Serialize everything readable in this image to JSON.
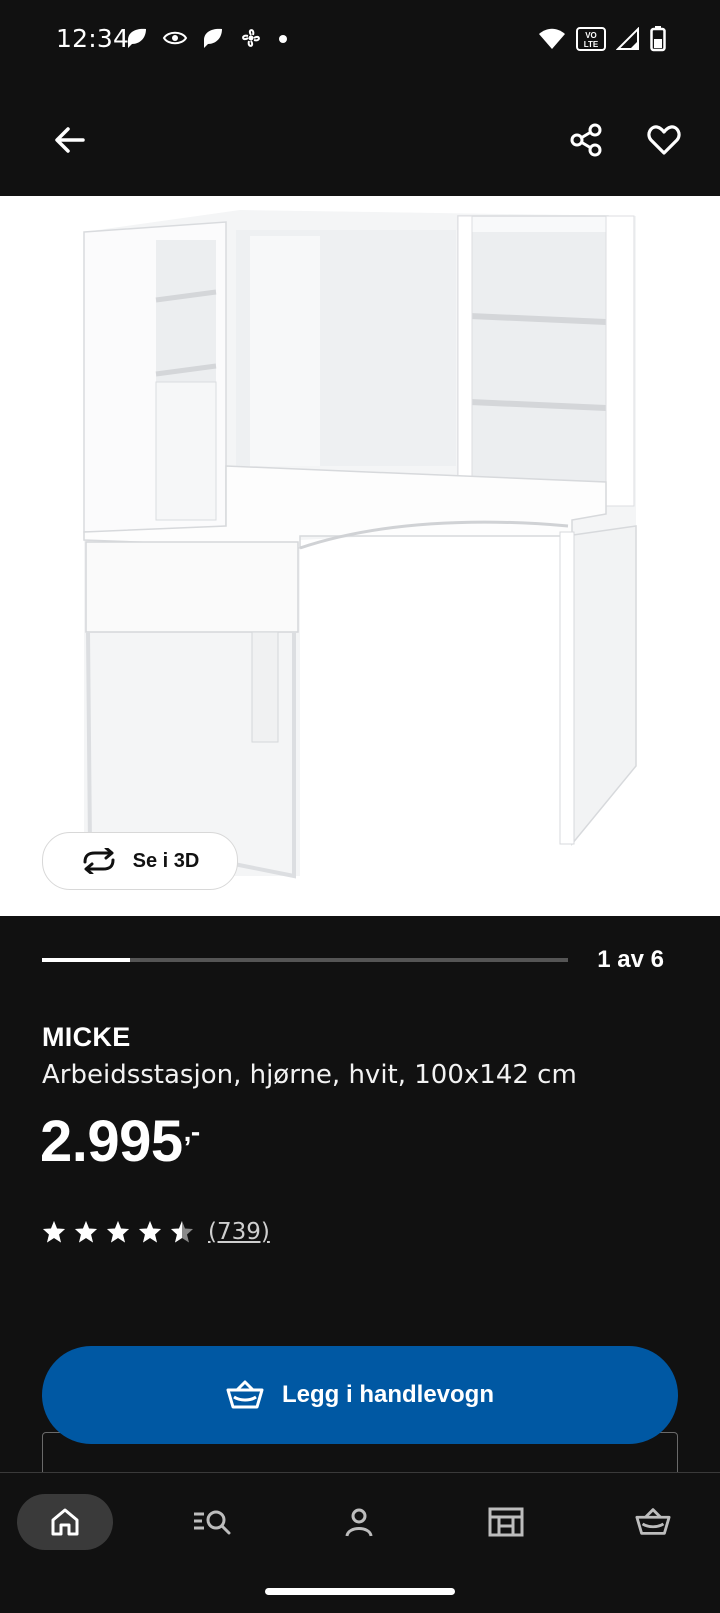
{
  "status_bar": {
    "time": "12:34",
    "left_icons": [
      "leaf-icon",
      "eye-icon",
      "leaf-icon",
      "fan-icon",
      "dot-icon"
    ],
    "right_icons": [
      "wifi-icon",
      "volte-icon",
      "signal-icon",
      "battery-icon"
    ],
    "volte_label": "VO LTE"
  },
  "top_bar": {
    "back_icon": "arrow-left-icon",
    "share_icon": "share-icon",
    "favorite_icon": "heart-icon"
  },
  "gallery": {
    "see_3d_label": "Se i 3D",
    "progress_fraction": 0.1667,
    "pager_text": "1 av 6"
  },
  "product": {
    "brand": "MICKE",
    "description": "Arbeidsstasjon, hjørne, hvit, 100x142 cm",
    "price": "2.995",
    "price_suffix": ",-",
    "rating_out_of_5": 4.5,
    "review_count": "(739)"
  },
  "cart_button": {
    "label": "Legg i handlevogn",
    "icon": "basket-icon"
  },
  "bottom_nav": {
    "items": [
      "home-icon",
      "search-list-icon",
      "profile-icon",
      "store-icon",
      "basket-icon"
    ],
    "active_index": 0
  },
  "colors": {
    "background": "#111111",
    "accent_blue": "#0058a3",
    "nav_active_bg": "#3a3a3a"
  }
}
